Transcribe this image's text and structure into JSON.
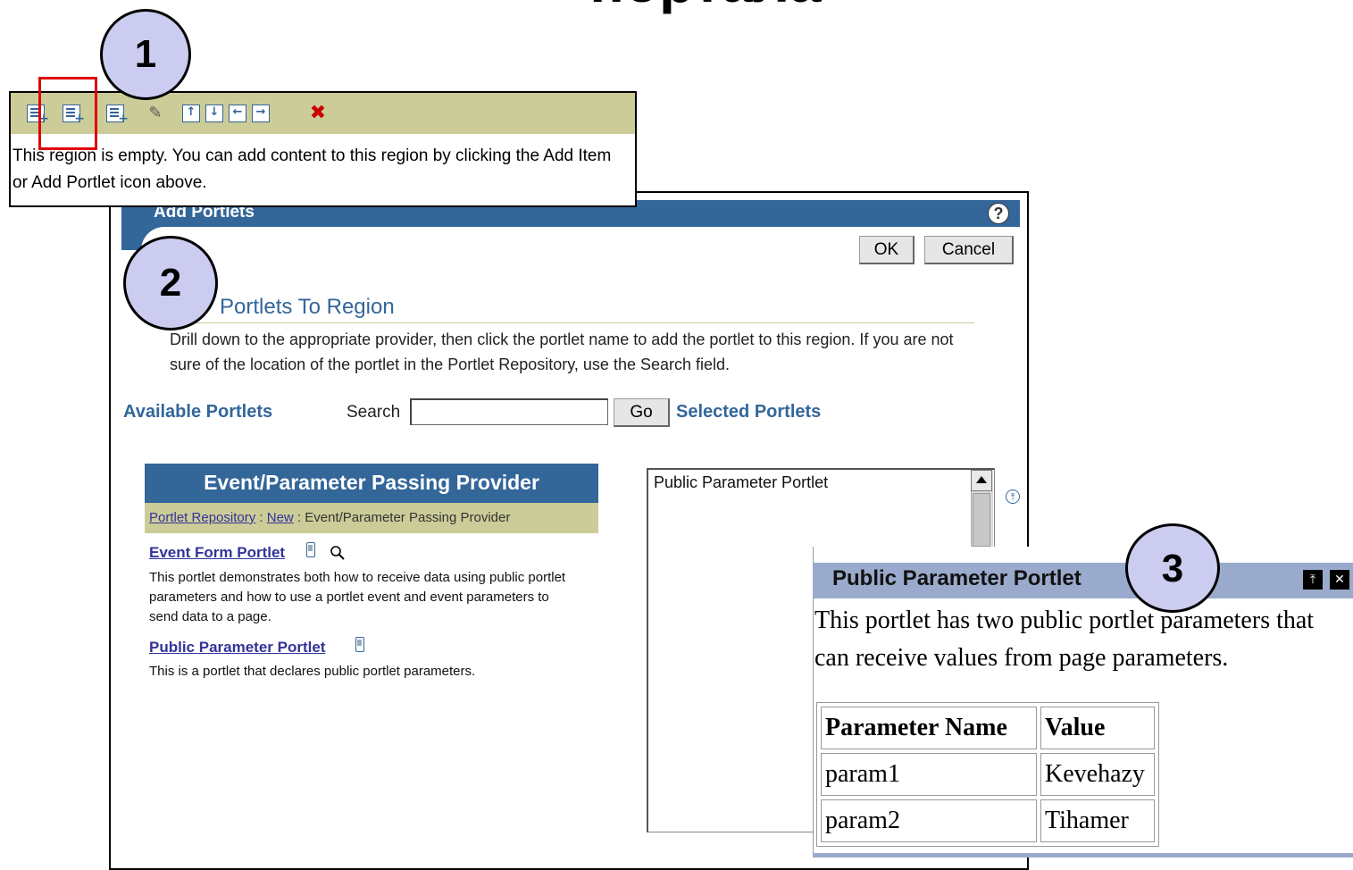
{
  "slide_title": "портала",
  "region_panel": {
    "message": "This region is empty. You can add content to this region by clicking the Add Item or Add Portlet icon above.",
    "toolbar_icons": [
      "add-item-icon",
      "add-portlet-icon",
      "add-subregion-icon",
      "edit-icon",
      "move-up-icon",
      "move-down-icon",
      "move-left-icon",
      "move-right-icon",
      "delete-icon"
    ]
  },
  "callouts": {
    "one": "1",
    "two": "2",
    "three": "3"
  },
  "add_portlets": {
    "header": "Add Portlets",
    "ok_label": "OK",
    "cancel_label": "Cancel",
    "section_title": "Portlets To Region",
    "instructions": "Drill down to the appropriate provider, then click the portlet name to add the portlet to this region. If you are not sure of the location of the portlet in the Portlet Repository, use the Search field.",
    "available_label": "Available Portlets",
    "search_label": "Search",
    "search_value": "",
    "go_label": "Go",
    "selected_label": "Selected Portlets",
    "provider": {
      "title": "Event/Parameter Passing Provider",
      "breadcrumb": {
        "link1": "Portlet Repository",
        "sep1": " : ",
        "link2": "New",
        "current": " : Event/Parameter Passing Provider"
      },
      "portlets": [
        {
          "name": "Event Form Portlet",
          "desc": "This portlet demonstrates both how to receive data using public portlet parameters and how to use a portlet event and event parameters to send data to a page."
        },
        {
          "name": "Public Parameter Portlet",
          "desc": "This is a portlet that declares public portlet parameters."
        }
      ]
    },
    "selected_items": [
      "Public Parameter Portlet"
    ]
  },
  "public_parameter_portlet": {
    "title": "Public Parameter Portlet",
    "description": "This portlet has two public portlet parameters that can receive values from page parameters.",
    "columns": [
      "Parameter Name",
      "Value"
    ],
    "rows": [
      [
        "param1",
        "Kevehazy"
      ],
      [
        "param2",
        "Tihamer"
      ]
    ]
  },
  "colors": {
    "header_blue": "#336699",
    "toolbar_khaki": "#cccc99",
    "highlight_red": "#e00000",
    "callout_fill": "#ccccf0",
    "portlet_header": "#99aacc"
  }
}
